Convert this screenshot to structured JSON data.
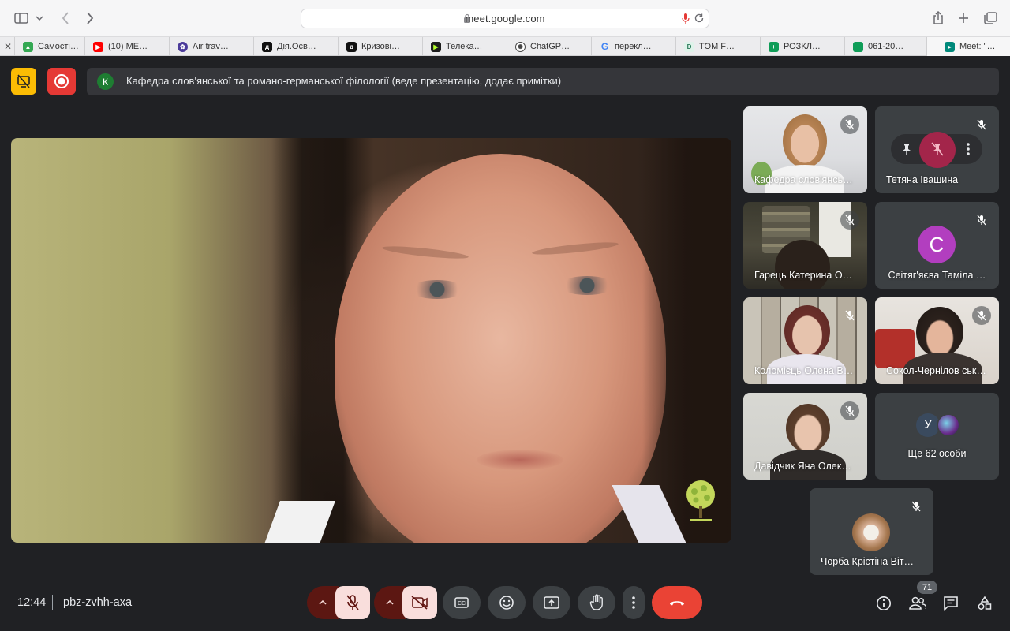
{
  "browser": {
    "url": "meet.google.com",
    "icons": [
      "sidebar-toggle-icon",
      "chevron-down-icon",
      "back-arrow-icon",
      "forward-arrow-icon",
      "lock-icon",
      "mic-icon",
      "reload-icon",
      "share-icon",
      "plus-icon",
      "tabs-overview-icon"
    ],
    "tabs": [
      {
        "label": "Самості…",
        "color": "#34a853"
      },
      {
        "label": "(10) ME…",
        "color": "#ff0000"
      },
      {
        "label": "Air trav…",
        "color": "#4b3b9a"
      },
      {
        "label": "Дія.Осв…",
        "color": "#111111"
      },
      {
        "label": "Кризові…",
        "color": "#111111"
      },
      {
        "label": "Телека…",
        "color": "#1d1d1d"
      },
      {
        "label": "ChatGP…",
        "color": "#444444"
      },
      {
        "label": "перекл…",
        "color": "#4285f4"
      },
      {
        "label": "TOM F…",
        "color": "#5fa88a"
      },
      {
        "label": "РОЗКЛ…",
        "color": "#0f9d58"
      },
      {
        "label": "061-20…",
        "color": "#0f9d58"
      },
      {
        "label": "Meet: \"…",
        "color": "#00897b"
      }
    ]
  },
  "meet": {
    "presenter": {
      "initial": "К",
      "text": "Кафедра слов'янської та романо-германської філології (веде презентацію, додає примітки)"
    },
    "participants": [
      {
        "name": "Кафедра слов'янсь…",
        "muted": true
      },
      {
        "name": "Тетяна Івашина",
        "muted": true,
        "hovered": true
      },
      {
        "name": "Гарець Катерина О…",
        "muted": true
      },
      {
        "name": "Сеітяг'яєва Таміла …",
        "muted": true,
        "avatar": "С",
        "avatar_color": "#b23ebf"
      },
      {
        "name": "Коломієць Олена В…",
        "muted": true
      },
      {
        "name": "Сокол-Чернілов ськ…",
        "muted": true
      },
      {
        "name": "Давідчик Яна Олек…",
        "muted": true
      },
      {
        "name": "Ще 62 особи",
        "avatar": "У"
      },
      {
        "name": "Чорба Крістіна Віт…",
        "muted": true
      }
    ],
    "bottom": {
      "time": "12:44",
      "meeting_code": "pbz-zvhh-axa",
      "people_count": "71"
    },
    "colors": {
      "background": "#202124",
      "tile": "#3c4043",
      "end_call": "#ea4335",
      "mute_active": "#f9dedc",
      "record": "#e53935",
      "accent_yellow": "#fbbc04"
    }
  }
}
